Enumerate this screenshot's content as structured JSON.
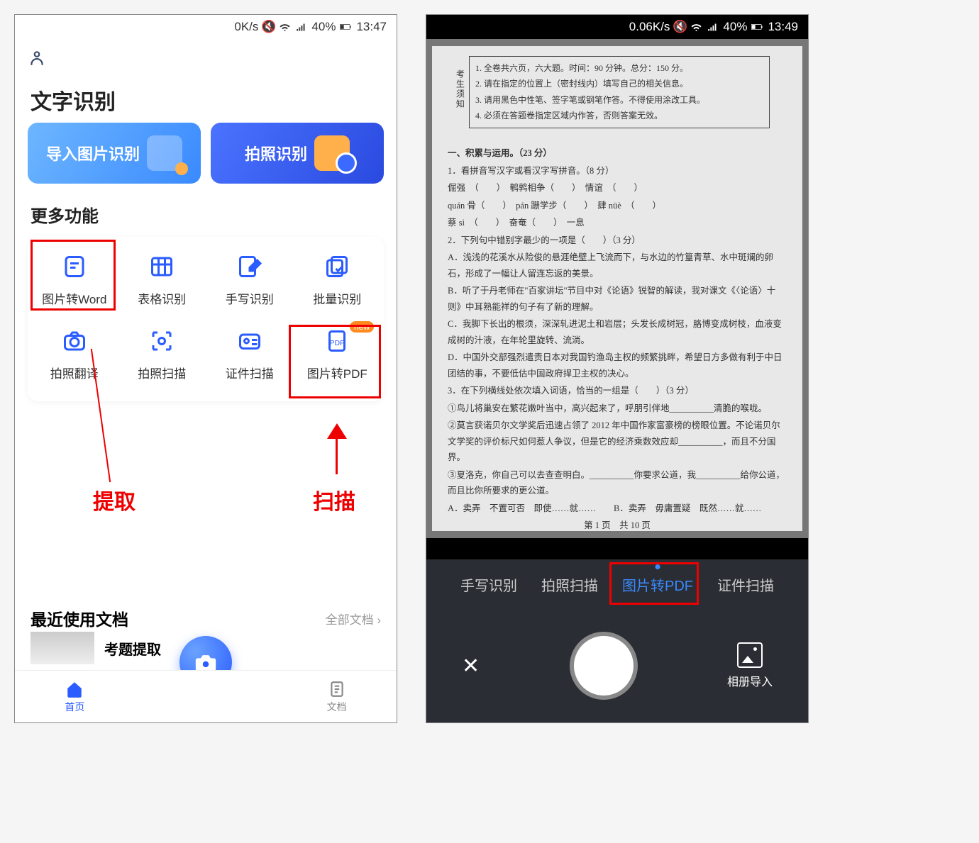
{
  "left": {
    "status": {
      "speed": "0K/s",
      "battery": "40%",
      "time": "13:47"
    },
    "title": "文字识别",
    "cards": {
      "import": "导入图片识别",
      "photo": "拍照识别"
    },
    "more_functions": "更多功能",
    "funcs": [
      {
        "label": "图片转Word"
      },
      {
        "label": "表格识别"
      },
      {
        "label": "手写识别"
      },
      {
        "label": "批量识别"
      },
      {
        "label": "拍照翻译"
      },
      {
        "label": "拍照扫描"
      },
      {
        "label": "证件扫描"
      },
      {
        "label": "图片转PDF",
        "badge": "new"
      }
    ],
    "recent": {
      "title": "最近使用文档",
      "all": "全部文档 ›",
      "item": "考题提取"
    },
    "nav": {
      "home": "首页",
      "docs": "文档"
    },
    "annotations": {
      "extract": "提取",
      "scan": "扫描"
    }
  },
  "right": {
    "status": {
      "speed": "0.06K/s",
      "battery": "40%",
      "time": "13:49"
    },
    "doc": {
      "notice_side": "考生须知",
      "notice": [
        "1. 全卷共六页，六大题。时间：90 分钟。总分：150 分。",
        "2. 请在指定的位置上（密封线内）填写自己的相关信息。",
        "3. 请用黑色中性笔、签字笔或钢笔作答。不得使用涂改工具。",
        "4. 必须在答题卷指定区域内作答，否则答案无效。"
      ],
      "body": [
        "一、积累与运用。（23 分）",
        "1．看拼音写汉字或看汉字写拼音。（8 分）",
        "倔强　（　　）　鹌鹑相争（　　）　情谊　（　　）",
        "quán 骨（　　）　pán 跚学步（　　）　肆 nüè　（　　）",
        "蔡 si　（　　）　奋奄（　　）　一息",
        "2．下列句中错别字最少的一项是（　　）（3 分）",
        "A．浅浅的花溪水从险俊的悬涯绝壁上飞流而下，与水边的竹篁青草、水中斑斓的卵石，形成了一幅让人留连忘返的美景。",
        "B．听了于丹老师在\"百家讲坛\"节目中对《论语》锐智的解读，我对课文《〈论语〉十则》中耳熟能祥的句子有了新的理解。",
        "C．我脚下长出的根须，深深轧进泥土和岩层；头发长成树冠，胳博变成树枝，血液变成树的汁液，在年轮里旋转、流淌。",
        "D．中国外交部强烈遣责日本对我国钓渔岛主权的频繁挑畔，希望日方多做有利于中日团结的事，不要低估中国政府捍卫主权的决心。",
        "3．在下列横线处依次填入词语，恰当的一组是（　　）（3 分）",
        "①鸟儿将巢安在繁花嫩叶当中，高兴起来了，呼朋引伴地__________清脆的喉咙。",
        "②莫言获诺贝尔文学奖后迅速占领了 2012 年中国作家富豪榜的榜眼位置。不论诺贝尔文学奖的评价标尺如何惹人争议，但是它的经济乘数效应却__________，而且不分国界。",
        "③夏洛克，你自己可以去查查明白。__________你要求公道，我__________给你公道，而且比你所要求的更公道。",
        "A．卖弄　不置可否　即使……就……　　B．卖弄　毋庸置疑　既然……就……",
        "第 1 页　共 10 页"
      ]
    },
    "modes": [
      "手写识别",
      "拍照扫描",
      "图片转PDF",
      "证件扫描"
    ],
    "active_mode_index": 2,
    "gallery_label": "相册导入"
  }
}
